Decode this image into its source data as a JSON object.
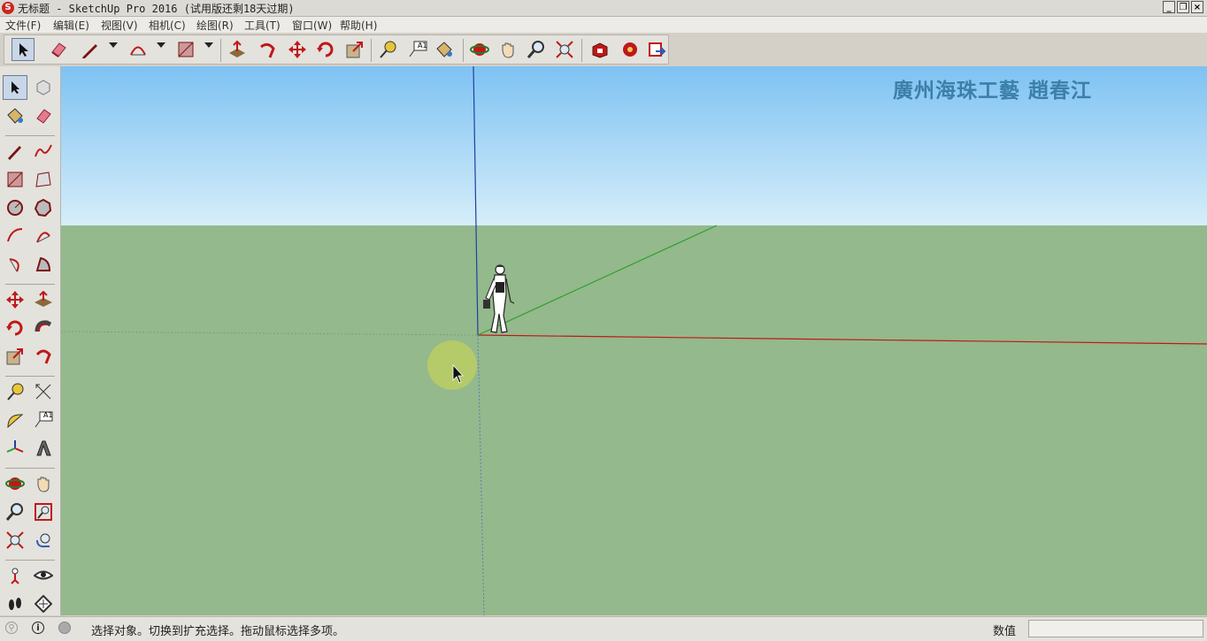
{
  "window": {
    "title": "无标题 - SketchUp Pro 2016 (试用版还剩18天过期)",
    "minimize_label": "_",
    "restore_label": "❐",
    "close_label": "×"
  },
  "menu": {
    "items": [
      {
        "label": "文件(F)"
      },
      {
        "label": "编辑(E)"
      },
      {
        "label": "视图(V)"
      },
      {
        "label": "相机(C)"
      },
      {
        "label": "绘图(R)"
      },
      {
        "label": "工具(T)"
      },
      {
        "label": "窗口(W)"
      },
      {
        "label": "帮助(H)"
      }
    ]
  },
  "toolbar": {
    "tools": [
      "select-icon",
      "eraser-icon",
      "pencil-icon",
      "arc-icon",
      "rectangle-icon",
      "push-pull-icon",
      "follow-me-icon",
      "move-icon",
      "rotate-icon",
      "scale-icon",
      "tape-measure-icon",
      "text-icon",
      "paint-bucket-icon",
      "orbit-icon",
      "pan-icon",
      "zoom-icon",
      "zoom-extents-icon",
      "warehouse-icon",
      "extension-warehouse-icon",
      "layout-icon"
    ],
    "text_tool_label": "A1"
  },
  "viewport": {
    "watermark": "廣州海珠工藝  趙春江",
    "sky_color": "#7ec2f3",
    "ground_color": "#94b98c"
  },
  "colors": {
    "red_axis": "#c01818",
    "green_axis": "#2ea02e",
    "blue_axis": "#2040a0",
    "chrome": "#e4e2dd"
  },
  "status": {
    "message": "选择对象。切换到扩充选择。拖动鼠标选择多项。",
    "value_label": "数值",
    "value": ""
  }
}
